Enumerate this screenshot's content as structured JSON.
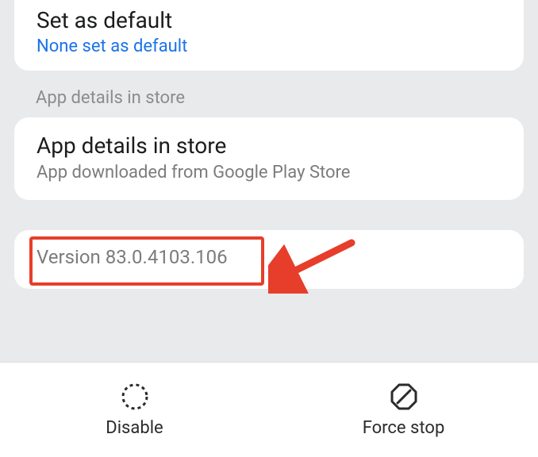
{
  "default_section": {
    "title": "Set as default",
    "status": "None set as default"
  },
  "store_section": {
    "header": "App details in store",
    "title": "App details in store",
    "subtitle": "App downloaded from Google Play Store"
  },
  "version_section": {
    "text": "Version 83.0.4103.106"
  },
  "bottom_bar": {
    "disable_label": "Disable",
    "force_stop_label": "Force stop"
  },
  "annotation": {
    "highlight_color": "#e63e2b"
  }
}
